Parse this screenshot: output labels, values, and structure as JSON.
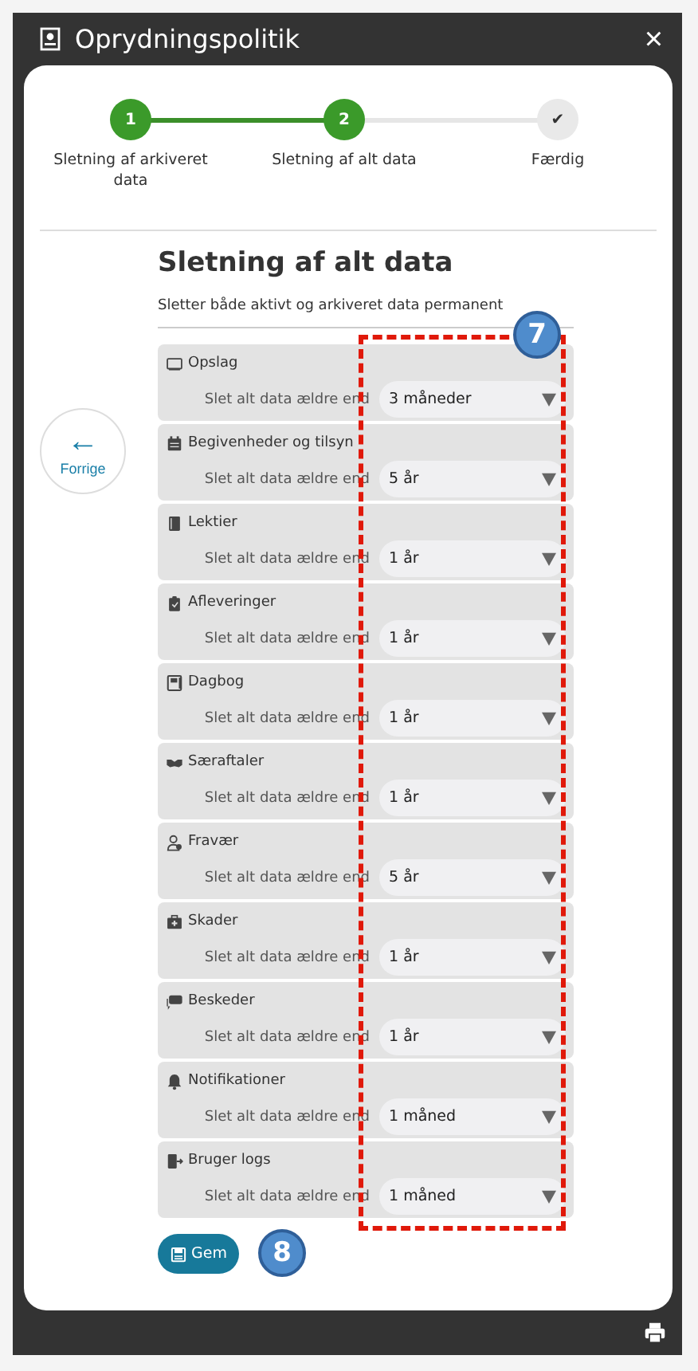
{
  "window": {
    "title": "Oprydningspolitik",
    "close": "×"
  },
  "steps": [
    {
      "number": "1",
      "label": "Sletning af arkiveret data",
      "completed": true
    },
    {
      "number": "2",
      "label": "Sletning af alt data",
      "completed": true
    },
    {
      "number": "✔",
      "label": "Færdig",
      "completed": false
    }
  ],
  "back_button": {
    "arrow": "←",
    "label": "Forrige"
  },
  "section": {
    "title": "Sletning af alt data",
    "subtitle": "Sletter både aktivt og arkiveret data permanent"
  },
  "rows": [
    {
      "kind": "board",
      "name": "Opslag",
      "label": "Slet alt data ældre end",
      "value": "3 måneder"
    },
    {
      "kind": "calendar",
      "name": "Begivenheder og tilsyn",
      "label": "Slet alt data ældre end",
      "value": "5 år"
    },
    {
      "kind": "book",
      "name": "Lektier",
      "label": "Slet alt data ældre end",
      "value": "1 år"
    },
    {
      "kind": "clipboard",
      "name": "Afleveringer",
      "label": "Slet alt data ældre end",
      "value": "1 år"
    },
    {
      "kind": "diary",
      "name": "Dagbog",
      "label": "Slet alt data ældre end",
      "value": "1 år"
    },
    {
      "kind": "handshake",
      "name": "Særaftaler",
      "label": "Slet alt data ældre end",
      "value": "1 år"
    },
    {
      "kind": "person",
      "name": "Fravær",
      "label": "Slet alt data ældre end",
      "value": "5 år"
    },
    {
      "kind": "firstaid",
      "name": "Skader",
      "label": "Slet alt data ældre end",
      "value": "1 år"
    },
    {
      "kind": "chat",
      "name": "Beskeder",
      "label": "Slet alt data ældre end",
      "value": "1 år"
    },
    {
      "kind": "bell",
      "name": "Notifikationer",
      "label": "Slet alt data ældre end",
      "value": "1 måned"
    },
    {
      "kind": "exit",
      "name": "Bruger logs",
      "label": "Slet alt data ældre end",
      "value": "1 måned"
    }
  ],
  "save_button": {
    "label": "Gem"
  },
  "annotations": [
    {
      "label": "7"
    },
    {
      "label": "8"
    }
  ]
}
